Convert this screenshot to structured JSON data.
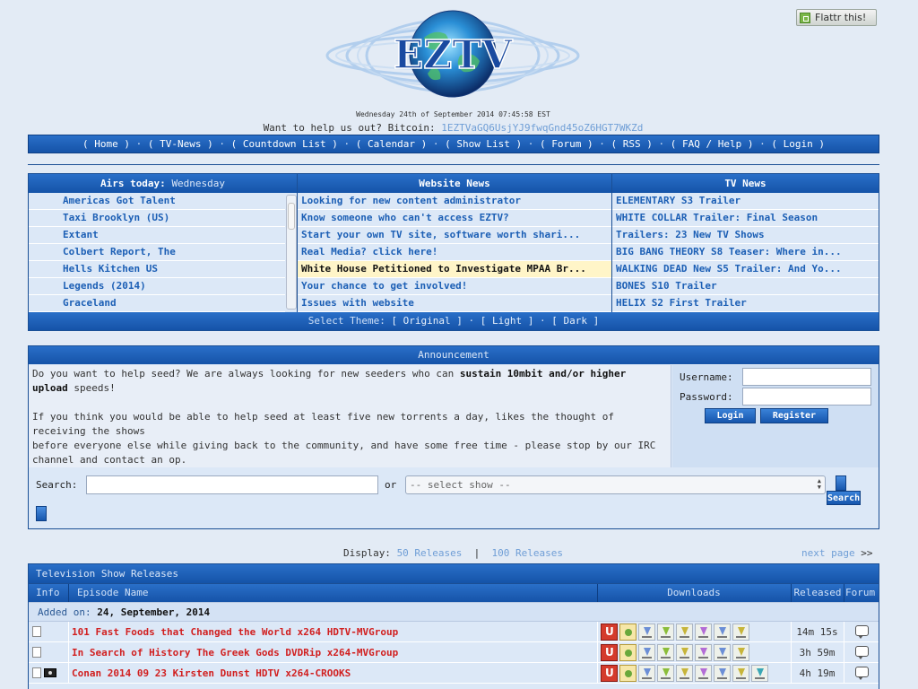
{
  "site": {
    "logo_text": "EZTV",
    "flattr_label": "Flattr this!",
    "datetime": "Wednesday 24th of September 2014 07:45:58 EST",
    "bitcoin_prompt": "Want to help us out? Bitcoin:",
    "bitcoin_address": "1EZTVaGQ6UsjYJ9fwqGnd45oZ6HGT7WKZd"
  },
  "nav": {
    "items": [
      {
        "label": "( Home )"
      },
      {
        "label": "( TV-News )"
      },
      {
        "label": "( Countdown List )"
      },
      {
        "label": "( Calendar )"
      },
      {
        "label": "( Show List )"
      },
      {
        "label": "( Forum )"
      },
      {
        "label": "( RSS )"
      },
      {
        "label": "( FAQ / Help )"
      },
      {
        "label": "( Login )"
      }
    ],
    "separator": "·"
  },
  "airs_today": {
    "heading": "Airs today:",
    "day": "Wednesday",
    "shows": [
      "Americas Got Talent",
      "Taxi Brooklyn (US)",
      "Extant",
      "Colbert Report, The",
      "Hells Kitchen US",
      "Legends (2014)",
      "Graceland"
    ]
  },
  "website_news": {
    "heading": "Website News",
    "items": [
      "Looking for new content administrator",
      "Know someone who can't access EZTV?",
      "Start your own TV site, software worth shari...",
      "Real Media? click here!",
      "White House Petitioned to Investigate MPAA Br...",
      "Your chance to get involved!",
      "Issues with website"
    ],
    "highlighted_index": 4
  },
  "tv_news": {
    "heading": "TV News",
    "items": [
      "ELEMENTARY S3 Trailer",
      "WHITE COLLAR Trailer: Final Season",
      "Trailers: 23 New TV Shows",
      "BIG BANG THEORY S8 Teaser: Where in...",
      "WALKING DEAD New S5 Trailer: And Yo...",
      "BONES S10 Trailer",
      "HELIX S2 First Trailer"
    ]
  },
  "theme": {
    "prompt": "Select Theme:",
    "original": "[ Original ]",
    "light": "[ Light ]",
    "dark": "[ Dark ]",
    "separator": "·"
  },
  "announcement": {
    "heading": "Announcement",
    "line1_pre": "Do you want to help seed? We are always looking for new seeders who can ",
    "line1_bold": "sustain 10mbit and/or higher upload",
    "line1_post": " speeds!",
    "line2": "If you think you would be able to help seed at least five new torrents a day, likes the thought of receiving the shows",
    "line3": "before everyone else while giving back to the community, and have some free time - please stop by our IRC channel and contact an op."
  },
  "login": {
    "username_label": "Username:",
    "password_label": "Password:",
    "username_value": "",
    "password_value": "",
    "login_button": "Login",
    "register_button": "Register"
  },
  "search": {
    "label": "Search:",
    "value": "",
    "or_label": "or",
    "select_placeholder": "-- select show --",
    "button": "Search"
  },
  "display": {
    "prompt": "Display:",
    "opt50": "50 Releases",
    "sep": "|",
    "opt100": "100 Releases",
    "next_page": "next page",
    "next_arrows": ">>"
  },
  "releases": {
    "title": "Television Show Releases",
    "columns": {
      "info": "Info",
      "episode": "Episode Name",
      "downloads": "Downloads",
      "released": "Released",
      "forum": "Forum"
    },
    "added_label": "Added on:",
    "added_date": "24, September, 2014",
    "rows": [
      {
        "name": "101 Fast Foods that Changed the World x264 HDTV-MVGroup",
        "age": "14m 15s"
      },
      {
        "name": "In Search of History The Greek Gods DVDRip x264-MVGroup",
        "age": "3h 59m"
      },
      {
        "name": "Conan 2014 09 23 Kirsten Dunst HDTV x264-CROOKS",
        "age": "4h 19m"
      }
    ]
  },
  "colors": {
    "header_blue": "#1553a8",
    "link_blue": "#1c5fb5",
    "release_red": "#d11f1f",
    "page_bg": "#e3ebf5",
    "highlight": "#fff5c8"
  },
  "icons": [
    "flattr-icon",
    "magnet-icon",
    "torrent-box-icon",
    "download-arrow-icon",
    "file-icon",
    "camera-icon",
    "forum-bubble-icon",
    "globe-logo"
  ]
}
